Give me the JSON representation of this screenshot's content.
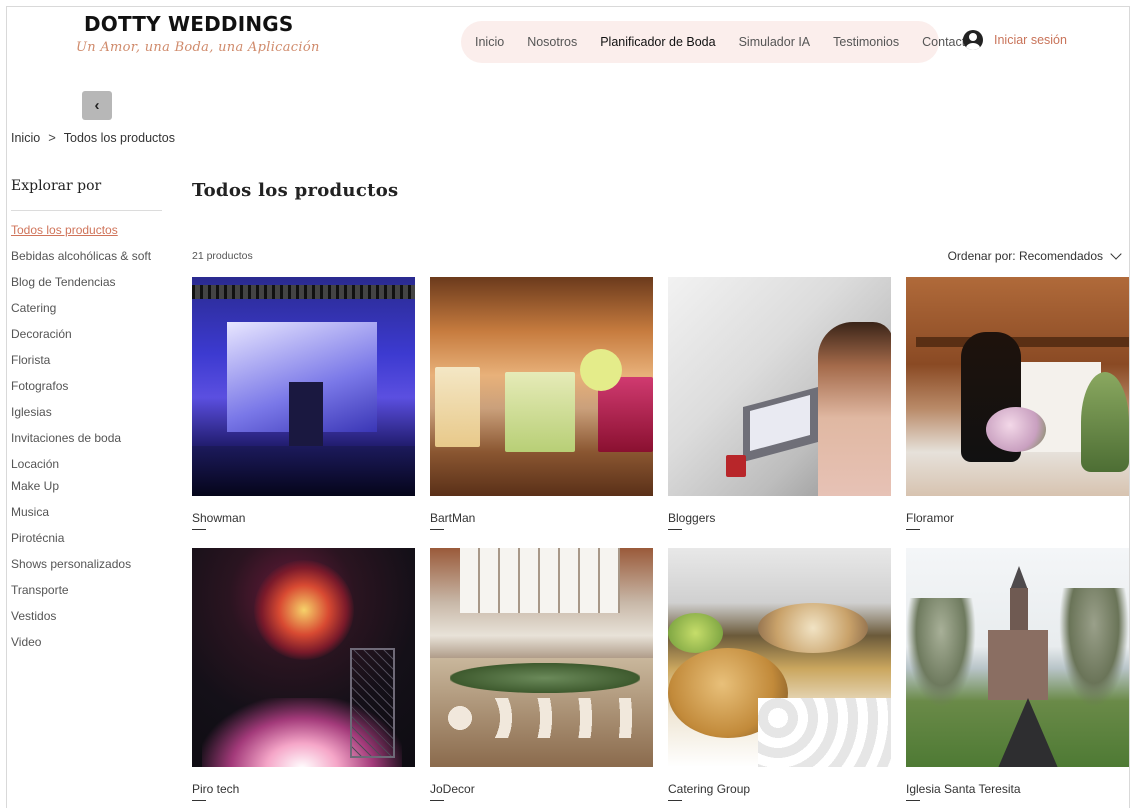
{
  "brand": {
    "title": "DOTTY WEDDINGS",
    "tagline": "Un Amor, una Boda, una Aplicación"
  },
  "nav": {
    "items": [
      {
        "label": "Inicio"
      },
      {
        "label": "Nosotros"
      },
      {
        "label": "Planificador de Boda"
      },
      {
        "label": "Simulador IA"
      },
      {
        "label": "Testimonios"
      },
      {
        "label": "Contacto"
      }
    ],
    "active_index": 2,
    "accent_bg": "#fbeeec"
  },
  "login": {
    "label": "Iniciar sesión",
    "icon": "user-avatar-icon",
    "color": "#c9745a"
  },
  "back_button": {
    "icon": "chevron-left-icon",
    "glyph": "‹"
  },
  "breadcrumb": {
    "items": [
      "Inicio",
      "Todos los productos"
    ],
    "separator": ">"
  },
  "sidebar": {
    "title": "Explorar por",
    "active_color": "#d0745a",
    "items": [
      {
        "label": "Todos los productos",
        "active": true
      },
      {
        "label": "Bebidas alcohólicas & soft"
      },
      {
        "label": "Blog de Tendencias"
      },
      {
        "label": "Catering"
      },
      {
        "label": "Decoración"
      },
      {
        "label": "Florista"
      },
      {
        "label": "Fotografos"
      },
      {
        "label": "Iglesias"
      },
      {
        "label": "Invitaciones de boda"
      },
      {
        "label": "Locación"
      },
      {
        "label": "Make Up"
      },
      {
        "label": "Musica"
      },
      {
        "label": "Pirotécnia"
      },
      {
        "label": "Shows personalizados"
      },
      {
        "label": "Transporte"
      },
      {
        "label": "Vestidos"
      },
      {
        "label": "Video"
      }
    ]
  },
  "main": {
    "title": "Todos los productos",
    "count": "21 productos",
    "sort_label": "Ordenar por: Recomendados",
    "products": [
      {
        "name": "Showman"
      },
      {
        "name": "BartMan"
      },
      {
        "name": "Bloggers"
      },
      {
        "name": "Floramor"
      },
      {
        "name": "Piro tech"
      },
      {
        "name": "JoDecor"
      },
      {
        "name": "Catering Group"
      },
      {
        "name": "Iglesia Santa Teresita"
      }
    ]
  }
}
